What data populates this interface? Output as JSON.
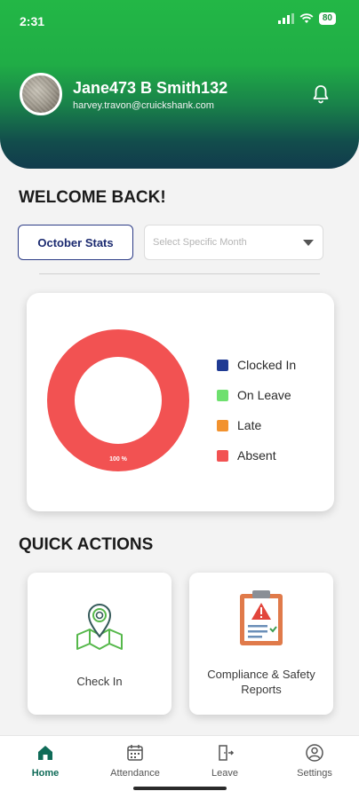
{
  "status_bar": {
    "time": "2:31",
    "battery": "80"
  },
  "profile": {
    "name": "Jane473 B Smith132",
    "email": "harvey.travon@cruickshank.com"
  },
  "welcome": "WELCOME BACK!",
  "stats_button": "October Stats",
  "month_select": {
    "placeholder": "Select Specific Month"
  },
  "chart_data": {
    "type": "pie",
    "categories": [
      "Clocked In",
      "On Leave",
      "Late",
      "Absent"
    ],
    "values": [
      0,
      0,
      0,
      100
    ],
    "colors": [
      "#1f3a93",
      "#6ee06e",
      "#f2922e",
      "#f25252"
    ],
    "data_label": "100 %",
    "legend_position": "right"
  },
  "quick_actions": {
    "title": "QUICK ACTIONS",
    "items": [
      {
        "label": "Check In",
        "icon": "map-location-icon"
      },
      {
        "label": "Compliance & Safety Reports",
        "icon": "clipboard-warning-icon"
      }
    ]
  },
  "bottom_nav": {
    "items": [
      {
        "label": "Home",
        "icon": "home-icon",
        "active": true
      },
      {
        "label": "Attendance",
        "icon": "calendar-icon",
        "active": false
      },
      {
        "label": "Leave",
        "icon": "door-exit-icon",
        "active": false
      },
      {
        "label": "Settings",
        "icon": "user-gear-icon",
        "active": false
      }
    ]
  }
}
